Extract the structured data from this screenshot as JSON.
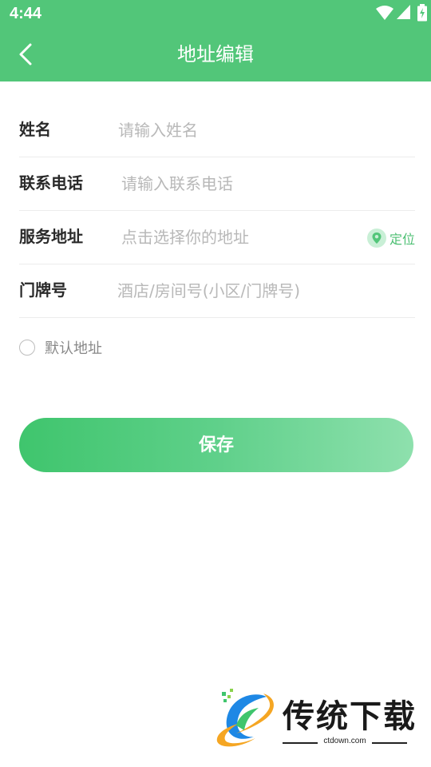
{
  "status_bar": {
    "time": "4:44"
  },
  "header": {
    "title": "地址编辑"
  },
  "form": {
    "name": {
      "label": "姓名",
      "placeholder": "请输入姓名"
    },
    "phone": {
      "label": "联系电话",
      "placeholder": "请输入联系电话"
    },
    "address": {
      "label": "服务地址",
      "placeholder": "点击选择你的地址",
      "locate_label": "定位"
    },
    "door": {
      "label": "门牌号",
      "placeholder": "酒店/房间号(小区/门牌号)"
    }
  },
  "default_address": {
    "label": "默认地址",
    "checked": false
  },
  "save_button": {
    "label": "保存"
  },
  "watermark": {
    "name": "传统下载",
    "domain": "ctdown.com"
  },
  "colors": {
    "primary": "#52c679",
    "locate": "#4cbf72"
  }
}
